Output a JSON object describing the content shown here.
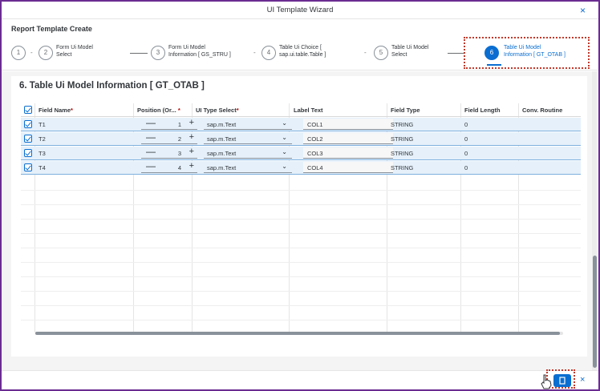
{
  "window": {
    "title": "UI Template Wizard",
    "close_icon": "close-icon"
  },
  "page": {
    "subtitle": "Report Template Create"
  },
  "wizard": {
    "steps": [
      {
        "number": "1",
        "label_l1": "",
        "label_l2": ""
      },
      {
        "number": "2",
        "label_l1": "Form Ui Model",
        "label_l2": "Select"
      },
      {
        "number": "3",
        "label_l1": "Form Ui Model",
        "label_l2": "Information [ GS_STRU ]"
      },
      {
        "number": "4",
        "label_l1": "Table Ui Choice [",
        "label_l2": "sap.ui.table.Table ]"
      },
      {
        "number": "5",
        "label_l1": "Table Ui Model",
        "label_l2": "Select"
      },
      {
        "number": "6",
        "label_l1": "Table Ui Model",
        "label_l2": "Information [ GT_OTAB ]"
      }
    ],
    "separator": "-"
  },
  "section": {
    "title": "6. Table Ui Model Information [ GT_OTAB ]"
  },
  "table": {
    "columns": {
      "field_name": "Field Name",
      "position": "Position (Or...",
      "ui_type": "UI Type Select",
      "label_text": "Label Text",
      "field_type": "Field Type",
      "field_length": "Field Length",
      "conv_routine": "Conv. Routine"
    },
    "required_mark": "*",
    "rows": [
      {
        "field_name": "T1",
        "position": "1",
        "ui_type": "sap.m.Text",
        "label_text": "COL1",
        "field_type": "STRING",
        "field_length": "0"
      },
      {
        "field_name": "T2",
        "position": "2",
        "ui_type": "sap.m.Text",
        "label_text": "COL2",
        "field_type": "STRING",
        "field_length": "0"
      },
      {
        "field_name": "T3",
        "position": "3",
        "ui_type": "sap.m.Text",
        "label_text": "COL3",
        "field_type": "STRING",
        "field_length": "0"
      },
      {
        "field_name": "T4",
        "position": "4",
        "ui_type": "sap.m.Text",
        "label_text": "COL4",
        "field_type": "STRING",
        "field_length": "0"
      }
    ]
  },
  "glyphs": {
    "minus": "—",
    "plus": "+",
    "chevron": "⌄",
    "close": "×"
  },
  "colors": {
    "accent": "#0a6ed1",
    "frame": "#6a2c91",
    "highlight": "#c0392b",
    "selected_row": "#e5f0fa"
  }
}
